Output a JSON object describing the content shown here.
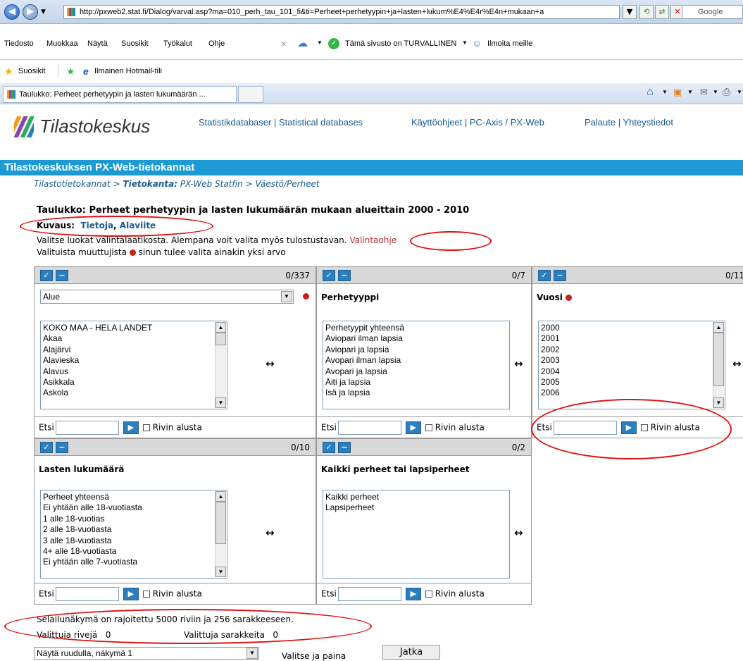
{
  "browser": {
    "url": "http://pxweb2.stat.fi/Dialog/varval.asp?ma=010_perh_tau_101_fi&ti=Perheet+perhetyypin+ja+lasten+lukum%E4%E4r%E4n+mukaan+a",
    "search_placeholder": "Google",
    "menu": [
      "Tiedosto",
      "Muokkaa",
      "Näytä",
      "Suosikit",
      "Työkalut",
      "Ohje"
    ],
    "security_text": "Tämä sivusto on TURVALLINEN",
    "report_text": "Ilmoita meille",
    "favorites_label": "Suosikit",
    "hotmail_label": "Ilmainen Hotmail-tili",
    "tab_title": "Taulukko: Perheet perhetyypin ja lasten lukumäärän ..."
  },
  "site": {
    "logo_text": "Tilastokeskus",
    "top_links": [
      "Statistikdatabaser | Statistical databases",
      "Käyttöohjeet | PC-Axis / PX-Web",
      "Palaute | Yhteystiedot"
    ],
    "banner": "Tilastokeskuksen PX-Web-tietokannat",
    "breadcrumb_1": "Tilastotietokannat",
    "breadcrumb_sep": " > ",
    "breadcrumb_2_bold": "Tietokanta:",
    "breadcrumb_2": "PX-Web Statfin",
    "breadcrumb_3": "Väestö/Perheet"
  },
  "page": {
    "title": "Taulukko: Perheet perhetyypin ja lasten lukumäärän mukaan alueittain 2000 - 2010",
    "kuvaus_label": "Kuvaus:",
    "kuvaus_link1": "Tietoja",
    "kuvaus_sep": ", ",
    "kuvaus_link2": "Alaviite",
    "info_text": "Valitse luokat valintalaatikosta. Alempana voit valita myös tulostustavan.",
    "info_link": "Valintaohje",
    "required_prefix": "Valituista muuttujista",
    "required_suffix": "sinun tulee valita ainakin yksi arvo"
  },
  "panels": {
    "alue": {
      "count": "0/337",
      "select_value": "Alue",
      "items": [
        "KOKO MAA - HELA LANDET",
        "Akaa",
        "Alajärvi",
        "Alavieska",
        "Alavus",
        "Asikkala",
        "Askola"
      ]
    },
    "perhetyyppi": {
      "count": "0/7",
      "heading": "Perhetyyppi",
      "items": [
        "Perhetyypit yhteensä",
        "Aviopari ilman lapsia",
        "Aviopari ja lapsia",
        "Avopari ilman lapsia",
        "Avopari ja lapsia",
        "Äiti ja lapsia",
        "Isä ja lapsia"
      ]
    },
    "vuosi": {
      "count": "0/11",
      "heading": "Vuosi",
      "items": [
        "2000",
        "2001",
        "2002",
        "2003",
        "2004",
        "2005",
        "2006"
      ]
    },
    "lasten": {
      "count": "0/10",
      "heading": "Lasten lukumäärä",
      "items": [
        "Perheet yhteensä",
        "Ei yhtään alle 18-vuotiasta",
        "1 alle 18-vuotias",
        "2 alle 18-vuotiasta",
        "3 alle 18-vuotiasta",
        "4+ alle 18-vuotiasta",
        "Ei yhtään alle 7-vuotiasta"
      ]
    },
    "kaikki": {
      "count": "0/2",
      "heading": "Kaikki perheet tai lapsiperheet",
      "items": [
        "Kaikki perheet",
        "Lapsiperheet"
      ]
    },
    "search_label": "Etsi",
    "checkbox_label": "Rivin alusta",
    "arrow": "↔"
  },
  "footer": {
    "limit_text": "Selailunäkymä on rajoitettu 5000 riviin ja 256 sarakkeeseen.",
    "rows_label": "Valittuja rivejä",
    "rows_value": "0",
    "cols_label": "Valittuja sarakkeita",
    "cols_value": "0",
    "output_select": "Näytä ruudulla, näkymä 1",
    "action_label": "Valitse ja paina",
    "continue_label": "Jatka"
  }
}
